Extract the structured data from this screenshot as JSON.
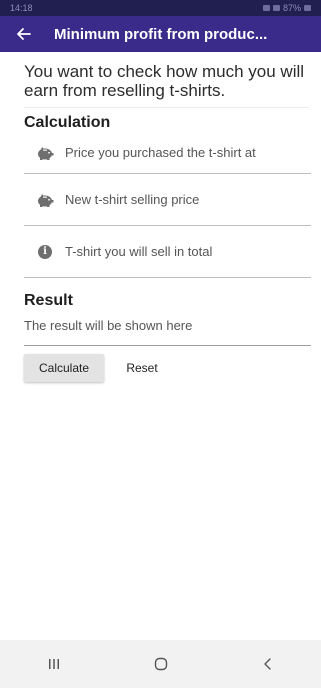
{
  "status_bar": {
    "time": "14:18",
    "battery": "87%"
  },
  "app_bar": {
    "title": "Minimum profit from produc..."
  },
  "intro": {
    "text": "You want to check how much you will earn from reselling t-shirts."
  },
  "calculation": {
    "title": "Calculation",
    "fields": [
      {
        "icon": "piggy-bank-icon",
        "placeholder": "Price you purchased the t-shirt at"
      },
      {
        "icon": "piggy-bank-icon",
        "placeholder": "New t-shirt selling price"
      },
      {
        "icon": "info-icon",
        "placeholder": "T-shirt you will sell in total"
      }
    ]
  },
  "result": {
    "title": "Result",
    "text": "The result will be shown here"
  },
  "buttons": {
    "calculate": "Calculate",
    "reset": "Reset"
  },
  "colors": {
    "app_bar": "#3a2a8a",
    "status_bar": "#211f4f"
  }
}
